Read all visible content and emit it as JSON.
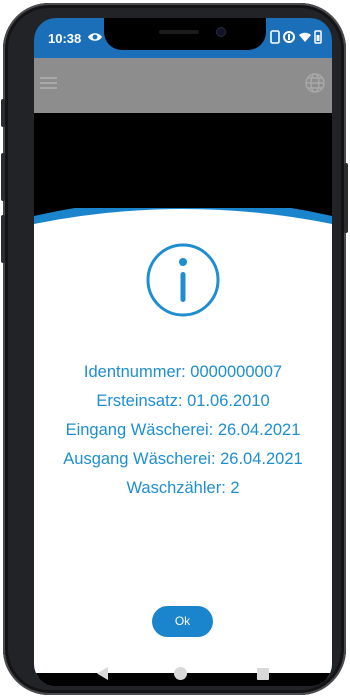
{
  "statusbar": {
    "time": "10:38",
    "icons_left": [
      "eye-icon"
    ],
    "icons_right": [
      "sim-icon",
      "data-saver-icon",
      "wifi-icon",
      "battery-icon"
    ]
  },
  "appbar": {
    "icons": [
      "menu-icon",
      "globe-icon"
    ]
  },
  "dialog": {
    "icon": "info-icon",
    "lines": {
      "identnummer": "Identnummer: 0000000007",
      "ersteinsatz": "Ersteinsatz: 01.06.2010",
      "eingang": "Eingang Wäscherei: 26.04.2021",
      "ausgang": "Ausgang Wäscherei: 26.04.2021",
      "waschzaehler": "Waschzähler: 2"
    },
    "ok_label": "Ok"
  },
  "navigation": {
    "icons": [
      "back-icon",
      "home-icon",
      "recents-icon"
    ]
  },
  "colors": {
    "accent": "#1a84cc",
    "text": "#1e8ed0",
    "statusbar": "#1a6fb8",
    "appbar": "#8d8d8d"
  }
}
